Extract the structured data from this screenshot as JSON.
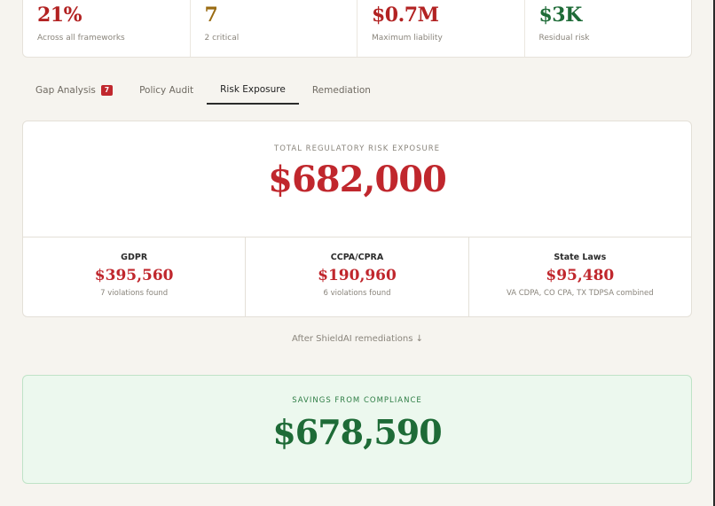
{
  "stats": [
    {
      "value": "21%",
      "label": "Across all frameworks",
      "color": "#b22222"
    },
    {
      "value": "7",
      "label": "2 critical",
      "color": "#9a6b12"
    },
    {
      "value": "$0.7M",
      "label": "Maximum liability",
      "color": "#b22222"
    },
    {
      "value": "$3K",
      "label": "Residual risk",
      "color": "#1e6b37"
    }
  ],
  "tabs": [
    {
      "label": "Gap Analysis",
      "badge": "7"
    },
    {
      "label": "Policy Audit"
    },
    {
      "label": "Risk Exposure",
      "active": true
    },
    {
      "label": "Remediation"
    }
  ],
  "risk": {
    "caption": "TOTAL REGULATORY RISK EXPOSURE",
    "total": "$682,000",
    "breakdown": [
      {
        "name": "GDPR",
        "amount": "$395,560",
        "note": "7 violations found"
      },
      {
        "name": "CCPA/CPRA",
        "amount": "$190,960",
        "note": "6 violations found"
      },
      {
        "name": "State Laws",
        "amount": "$95,480",
        "note": "VA CDPA, CO CPA, TX TDPSA combined"
      }
    ]
  },
  "after_link": "After ShieldAI remediations ↓",
  "savings": {
    "caption": "SAVINGS FROM COMPLIANCE",
    "total": "$678,590"
  }
}
